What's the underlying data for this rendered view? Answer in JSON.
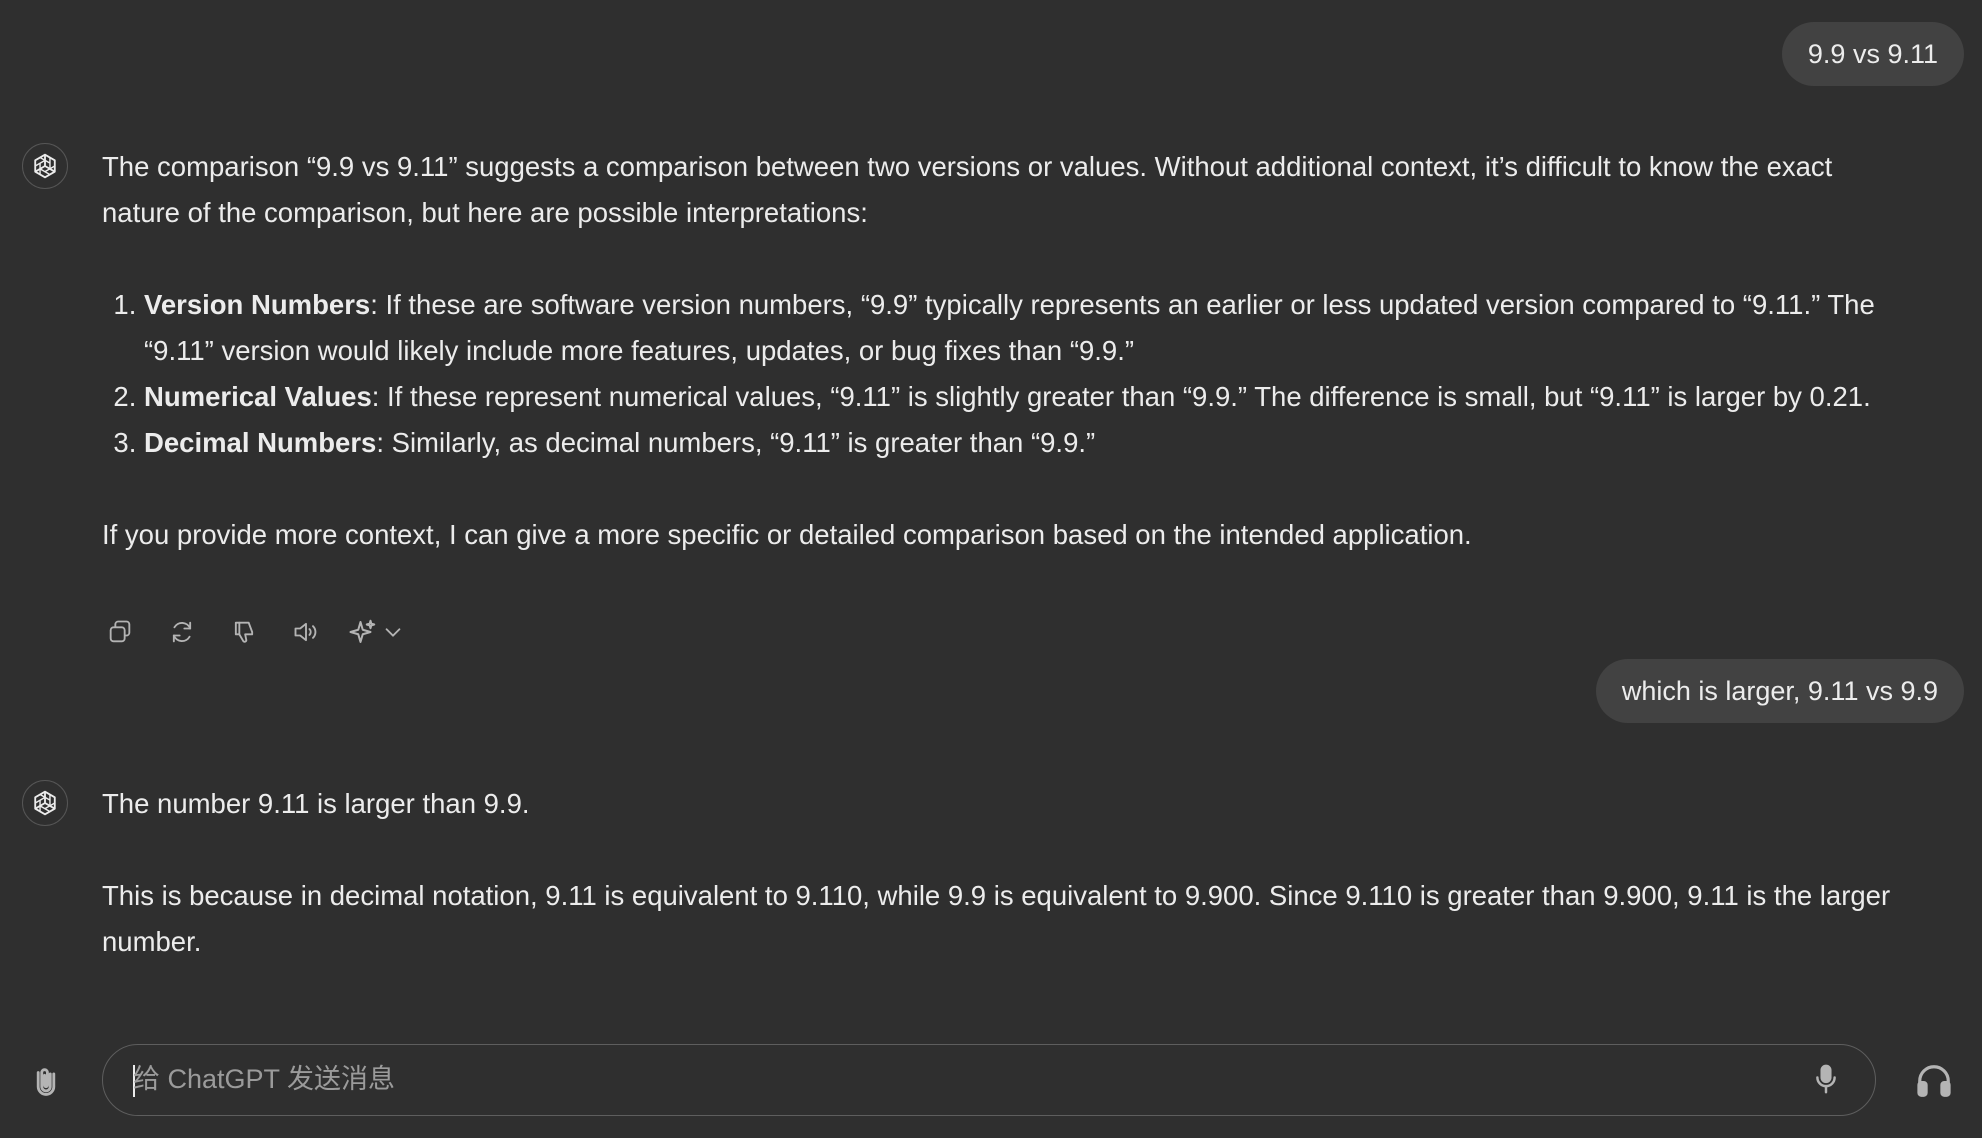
{
  "colors": {
    "background": "#2f2f2f",
    "user_bubble": "#424242",
    "text": "#ececec",
    "muted": "#9b9b9b",
    "icon": "#b4b4b4"
  },
  "messages": {
    "user_1": {
      "text": "9.9 vs 9.11"
    },
    "assistant_1": {
      "intro": "The comparison “9.9 vs 9.11” suggests a comparison between two versions or values. Without additional context, it’s difficult to know the exact nature of the comparison, but here are possible interpretations:",
      "items": [
        {
          "title": "Version Numbers",
          "text": ": If these are software version numbers, “9.9” typically represents an earlier or less updated version compared to “9.11.” The “9.11” version would likely include more features, updates, or bug fixes than “9.9.”"
        },
        {
          "title": "Numerical Values",
          "text": ": If these represent numerical values, “9.11” is slightly greater than “9.9.” The difference is small, but “9.11” is larger by 0.21."
        },
        {
          "title": "Decimal Numbers",
          "text": ": Similarly, as decimal numbers, “9.11” is greater than “9.9.”"
        }
      ],
      "outro": "If you provide more context, I can give a more specific or detailed comparison based on the intended application."
    },
    "actions": [
      {
        "icon": "copy-icon"
      },
      {
        "icon": "regenerate-icon"
      },
      {
        "icon": "thumbs-down-icon"
      },
      {
        "icon": "read-aloud-icon"
      },
      {
        "icon": "sparkle-icon"
      },
      {
        "icon": "chevron-down-icon"
      }
    ],
    "user_2": {
      "text": "which is larger, 9.11 vs 9.9"
    },
    "assistant_2": {
      "para1": "The number 9.11 is larger than 9.9.",
      "para2": "This is because in decimal notation, 9.11 is equivalent to 9.110, while 9.9 is equivalent to 9.900. Since 9.110 is greater than 9.900, 9.11 is the larger number."
    }
  },
  "composer": {
    "placeholder": "给 ChatGPT 发送消息",
    "value": "",
    "attach_icon": "paperclip-icon",
    "mic_icon": "microphone-icon",
    "voice_icon": "headphones-icon"
  }
}
